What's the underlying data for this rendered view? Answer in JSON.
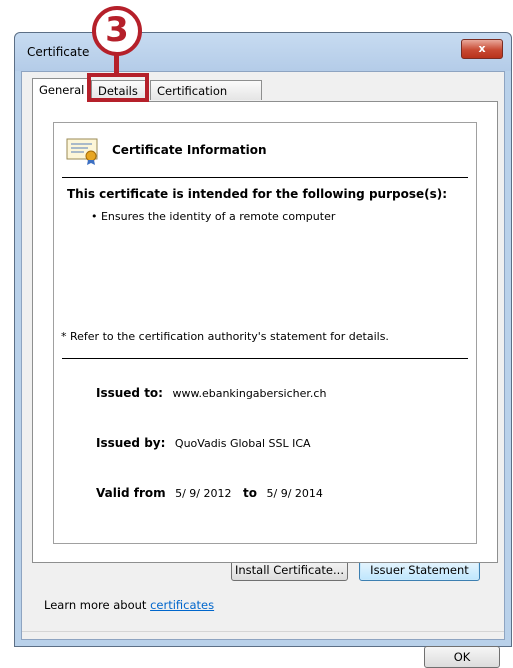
{
  "window": {
    "title": "Certificate",
    "close_label": "x"
  },
  "tabs": [
    {
      "label": "General"
    },
    {
      "label": "Details"
    },
    {
      "label": "Certification Path"
    }
  ],
  "general": {
    "info_title": "Certificate Information",
    "purpose_heading": "This certificate is intended for the following purpose(s):",
    "purposes": [
      "• Ensures the identity of a remote computer"
    ],
    "footnote": "* Refer to the certification authority's statement for details.",
    "issued_to_label": "Issued to:",
    "issued_to_value": "www.ebankingabersicher.ch",
    "issued_by_label": "Issued by:",
    "issued_by_value": "QuoVadis Global SSL ICA",
    "valid_from_label": "Valid from",
    "valid_from_value": "5/ 9/ 2012",
    "valid_to_label": "to",
    "valid_to_value": "5/ 9/ 2014"
  },
  "buttons": {
    "install": "Install Certificate...",
    "issuer_statement": "Issuer Statement",
    "ok": "OK"
  },
  "learn_more": {
    "prefix": "Learn more about ",
    "link": "certificates"
  },
  "annotation": {
    "step_number": "3"
  }
}
